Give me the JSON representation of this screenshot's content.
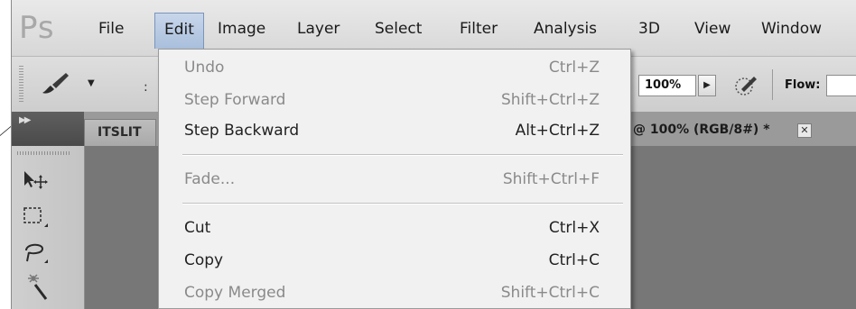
{
  "app": {
    "logo": "Ps"
  },
  "menubar": {
    "items": [
      "File",
      "Edit",
      "Image",
      "Layer",
      "Select",
      "Filter",
      "Analysis",
      "3D",
      "View",
      "Window"
    ],
    "active": "Edit"
  },
  "options_bar": {
    "colon_left": ":",
    "colon_pct": ":",
    "opacity_value": "100%",
    "flow_label": "Flow:",
    "flow_value": ""
  },
  "document": {
    "tab_label": "ITSLIT",
    "title_suffix": "@ 100% (RGB/8#) *",
    "close_glyph": "✕"
  },
  "edit_menu": {
    "items": [
      {
        "label": "Undo",
        "shortcut": "Ctrl+Z",
        "enabled": false
      },
      {
        "label": "Step Forward",
        "shortcut": "Shift+Ctrl+Z",
        "enabled": false
      },
      {
        "label": "Step Backward",
        "shortcut": "Alt+Ctrl+Z",
        "enabled": true
      },
      {
        "label": "Fade...",
        "shortcut": "Shift+Ctrl+F",
        "enabled": false
      },
      {
        "label": "Cut",
        "shortcut": "Ctrl+X",
        "enabled": true
      },
      {
        "label": "Copy",
        "shortcut": "Ctrl+C",
        "enabled": true
      },
      {
        "label": "Copy Merged",
        "shortcut": "Shift+Ctrl+C",
        "enabled": false
      }
    ]
  },
  "icons": {
    "brush": "brush-tool-icon",
    "airbrush": "airbrush-icon",
    "move": "move-tool-icon",
    "marquee": "marquee-tool-icon",
    "lasso": "lasso-tool-icon",
    "magic_wand": "magic-wand-icon"
  },
  "colors": {
    "menu_active_bg": "#b7c9e2",
    "disabled_text": "#8a8a8a",
    "menu_bg": "#f1f1f1"
  }
}
